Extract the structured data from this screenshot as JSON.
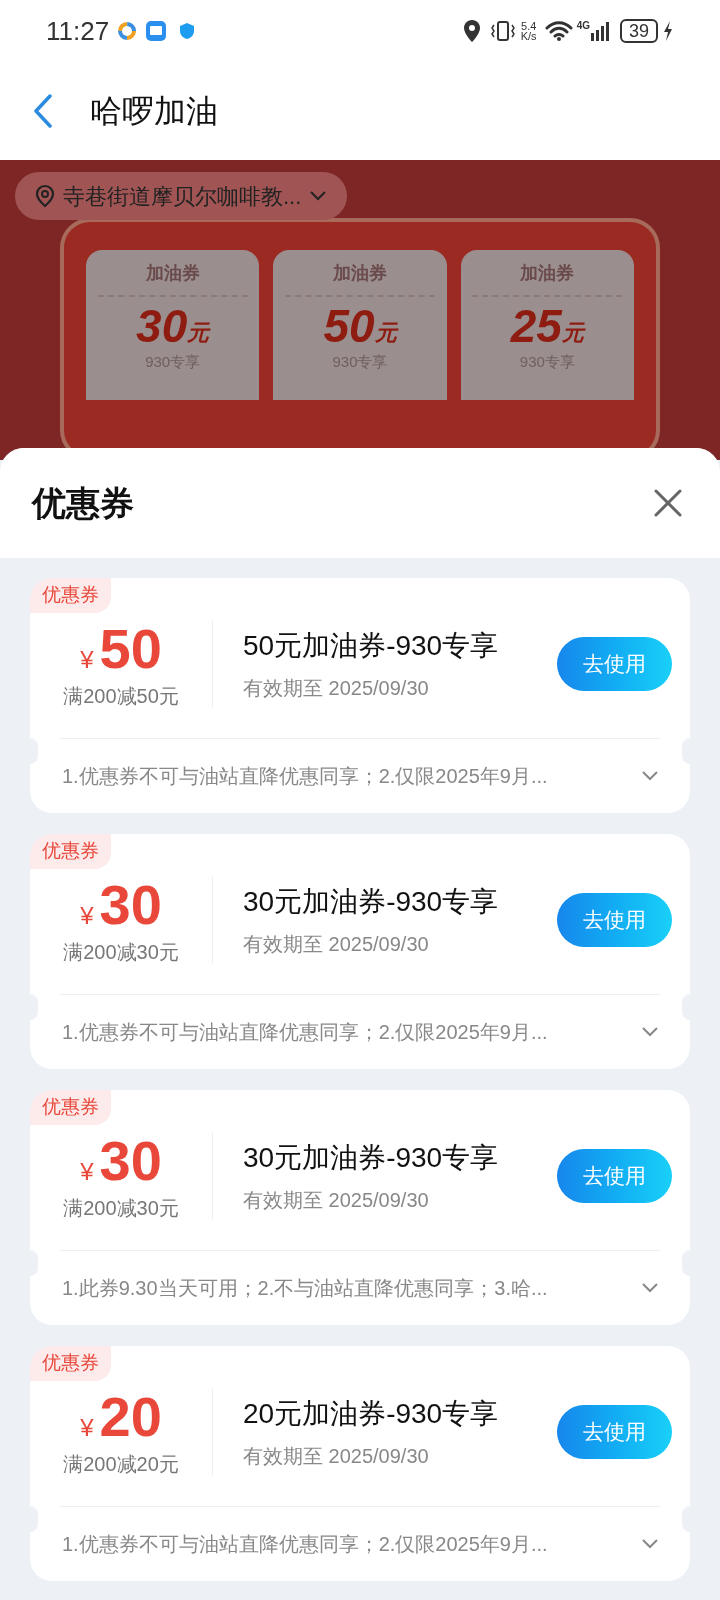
{
  "status_bar": {
    "time": "11:27",
    "speed_value": "5.4",
    "speed_unit": "K/s",
    "network": "4G",
    "battery": "39"
  },
  "header": {
    "title": "哈啰加油"
  },
  "banner": {
    "location": "寺巷街道摩贝尔咖啡教...",
    "tickets": [
      {
        "label": "加油券",
        "amount": "30",
        "unit": "元",
        "note": "930专享"
      },
      {
        "label": "加油券",
        "amount": "50",
        "unit": "元",
        "note": "930专享"
      },
      {
        "label": "加油券",
        "amount": "25",
        "unit": "元",
        "note": "930专享"
      }
    ]
  },
  "sheet": {
    "title": "优惠券",
    "coupons": [
      {
        "tag": "优惠券",
        "currency": "¥",
        "amount": "50",
        "condition": "满200减50元",
        "name": "50元加油券-930专享",
        "validity": "有效期至 2025/09/30",
        "button": "去使用",
        "rules": "1.优惠券不可与油站直降优惠同享；2.仅限2025年9月..."
      },
      {
        "tag": "优惠券",
        "currency": "¥",
        "amount": "30",
        "condition": "满200减30元",
        "name": "30元加油券-930专享",
        "validity": "有效期至 2025/09/30",
        "button": "去使用",
        "rules": "1.优惠券不可与油站直降优惠同享；2.仅限2025年9月..."
      },
      {
        "tag": "优惠券",
        "currency": "¥",
        "amount": "30",
        "condition": "满200减30元",
        "name": "30元加油券-930专享",
        "validity": "有效期至 2025/09/30",
        "button": "去使用",
        "rules": "1.此券9.30当天可用；2.不与油站直降优惠同享；3.哈..."
      },
      {
        "tag": "优惠券",
        "currency": "¥",
        "amount": "20",
        "condition": "满200减20元",
        "name": "20元加油券-930专享",
        "validity": "有效期至 2025/09/30",
        "button": "去使用",
        "rules": "1.优惠券不可与油站直降优惠同享；2.仅限2025年9月..."
      }
    ]
  }
}
